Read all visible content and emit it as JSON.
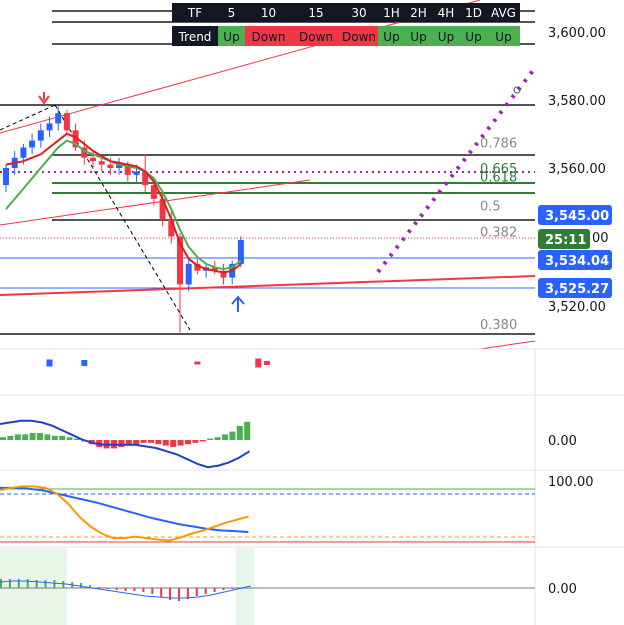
{
  "trend_table": {
    "header_row": [
      "TF",
      "5",
      "10",
      "15",
      "30",
      "1H",
      "2H",
      "4H",
      "1D",
      "AVG"
    ],
    "trend_row": [
      "Trend",
      "Up",
      "Down",
      "Down",
      "Down",
      "Up",
      "Up",
      "Up",
      "Up",
      "Up"
    ],
    "colors": {
      "up": "#4caf50",
      "down": "#f23645",
      "header_bg": "#131722",
      "header_text": "#ffffff"
    }
  },
  "price_axis": {
    "ticks": [
      "3,600.00",
      "3,580.00",
      "3,560.00",
      "3,520.00"
    ],
    "tags": [
      {
        "text": "3,545.00",
        "color": "#2962ff"
      },
      {
        "text": "25:11",
        "color": "#2e7d32"
      },
      {
        "text": "3,534.04",
        "color": "#2962ff"
      },
      {
        "text": "3,525.27",
        "color": "#2962ff"
      }
    ]
  },
  "fib_levels": [
    {
      "label": "0.786",
      "value": 3567.5,
      "color": "#888888"
    },
    {
      "label": "0.665",
      "value": 3560.0,
      "color": "#2e7d32"
    },
    {
      "label": "0.618",
      "value": 3557.5,
      "color": "#2e7d32"
    },
    {
      "label": "0.5",
      "value": 3549.0,
      "color": "#888888"
    },
    {
      "label": "0.382",
      "value": 3541.5,
      "color": "#888888"
    },
    {
      "label": "0.380",
      "value": 3514.5,
      "color": "#888888"
    }
  ],
  "indicator_labels": {
    "macd_zero": "0.00",
    "rsi_hundred": "100.00",
    "osc_zero": "0.00"
  },
  "chart_data": {
    "type": "candlestick",
    "price_range": [
      3510,
      3612
    ],
    "candles": [
      {
        "o": 3555,
        "h": 3561,
        "l": 3553,
        "c": 3560
      },
      {
        "o": 3560,
        "h": 3565,
        "l": 3558,
        "c": 3563
      },
      {
        "o": 3563,
        "h": 3567,
        "l": 3561,
        "c": 3566
      },
      {
        "o": 3566,
        "h": 3570,
        "l": 3564,
        "c": 3568
      },
      {
        "o": 3568,
        "h": 3573,
        "l": 3566,
        "c": 3571
      },
      {
        "o": 3571,
        "h": 3575,
        "l": 3569,
        "c": 3573
      },
      {
        "o": 3573,
        "h": 3578,
        "l": 3571,
        "c": 3576
      },
      {
        "o": 3576,
        "h": 3577,
        "l": 3570,
        "c": 3571
      },
      {
        "o": 3571,
        "h": 3573,
        "l": 3565,
        "c": 3566
      },
      {
        "o": 3566,
        "h": 3568,
        "l": 3561,
        "c": 3563
      },
      {
        "o": 3563,
        "h": 3565,
        "l": 3560,
        "c": 3562
      },
      {
        "o": 3562,
        "h": 3564,
        "l": 3559,
        "c": 3561
      },
      {
        "o": 3561,
        "h": 3563,
        "l": 3558,
        "c": 3560
      },
      {
        "o": 3560,
        "h": 3563,
        "l": 3558,
        "c": 3561
      },
      {
        "o": 3561,
        "h": 3562,
        "l": 3556,
        "c": 3558
      },
      {
        "o": 3558,
        "h": 3561,
        "l": 3556,
        "c": 3559
      },
      {
        "o": 3559,
        "h": 3564,
        "l": 3553,
        "c": 3555
      },
      {
        "o": 3555,
        "h": 3557,
        "l": 3549,
        "c": 3551
      },
      {
        "o": 3551,
        "h": 3553,
        "l": 3543,
        "c": 3545
      },
      {
        "o": 3545,
        "h": 3548,
        "l": 3538,
        "c": 3540
      },
      {
        "o": 3540,
        "h": 3541,
        "l": 3512,
        "c": 3526
      },
      {
        "o": 3526,
        "h": 3534,
        "l": 3524,
        "c": 3532
      },
      {
        "o": 3532,
        "h": 3534,
        "l": 3529,
        "c": 3530
      },
      {
        "o": 3530,
        "h": 3532,
        "l": 3528,
        "c": 3531
      },
      {
        "o": 3531,
        "h": 3533,
        "l": 3529,
        "c": 3530
      },
      {
        "o": 3530,
        "h": 3532,
        "l": 3526,
        "c": 3528
      },
      {
        "o": 3528,
        "h": 3533,
        "l": 3526,
        "c": 3532
      },
      {
        "o": 3532,
        "h": 3540,
        "l": 3531,
        "c": 3539
      }
    ],
    "ema_red": [
      3561,
      3561.5,
      3562,
      3563,
      3564,
      3566,
      3568,
      3570,
      3569,
      3567,
      3565,
      3563.5,
      3562,
      3561.5,
      3561,
      3560.5,
      3559,
      3556,
      3551,
      3545,
      3538,
      3533.5,
      3531.5,
      3530.5,
      3530,
      3529.5,
      3530,
      3532
    ],
    "ema_green": [
      3548,
      3551,
      3554,
      3557,
      3560,
      3563,
      3566,
      3568,
      3567,
      3565,
      3564,
      3563,
      3562,
      3561,
      3560.5,
      3560,
      3559,
      3557,
      3553,
      3548,
      3542,
      3537,
      3534,
      3532,
      3531,
      3530.5,
      3531,
      3533
    ],
    "volume_markers": [
      {
        "index": 1,
        "color": "#2962ff",
        "size": 7
      },
      {
        "index": 5,
        "color": "#2962ff",
        "size": 6
      },
      {
        "index": 18,
        "color": "#f23645",
        "size": 3
      },
      {
        "index": 25,
        "color": "#f23645",
        "size": 9
      },
      {
        "index": 26,
        "color": "#f23645",
        "size": 4
      }
    ],
    "macd_histogram": [
      2,
      3,
      4,
      4,
      5,
      5,
      4,
      3,
      3,
      2,
      1,
      -1,
      -3,
      -5,
      -6,
      -6,
      -5,
      -4,
      -3,
      -2,
      -2,
      -3,
      -4,
      -5,
      -4,
      -3,
      -2,
      -1,
      1,
      2,
      4,
      6,
      10,
      13
    ],
    "macd_line": [
      10,
      11,
      12,
      12,
      11,
      9,
      6,
      3,
      0,
      -2,
      -3,
      -3,
      -3,
      -3,
      -4,
      -5,
      -7,
      -9,
      -12,
      -15,
      -17,
      -16,
      -14,
      -11,
      -7
    ],
    "rsi_orange": [
      92,
      95,
      97,
      97,
      95,
      88,
      75,
      58,
      45,
      36,
      30,
      30,
      32,
      30,
      28,
      27,
      31,
      36,
      40,
      45,
      50,
      54,
      58
    ],
    "rsi_blue": [
      95,
      95,
      94,
      92,
      88,
      84,
      80,
      76,
      71,
      66,
      61,
      56,
      52,
      48,
      45,
      42,
      40,
      39,
      38
    ],
    "osc_histogram": [
      9,
      9,
      9,
      9,
      8,
      8,
      8,
      7,
      6,
      5,
      3,
      1,
      -1,
      -2,
      -3,
      -3,
      -4,
      -6,
      -9,
      -12,
      -13,
      -11,
      -8,
      -6,
      -4,
      -2,
      -1,
      0
    ],
    "osc_line": [
      6,
      7,
      7,
      6,
      5,
      4,
      2,
      0,
      -2,
      -4,
      -6,
      -8,
      -9,
      -10,
      -10,
      -9,
      -7,
      -4,
      -1,
      2
    ]
  }
}
